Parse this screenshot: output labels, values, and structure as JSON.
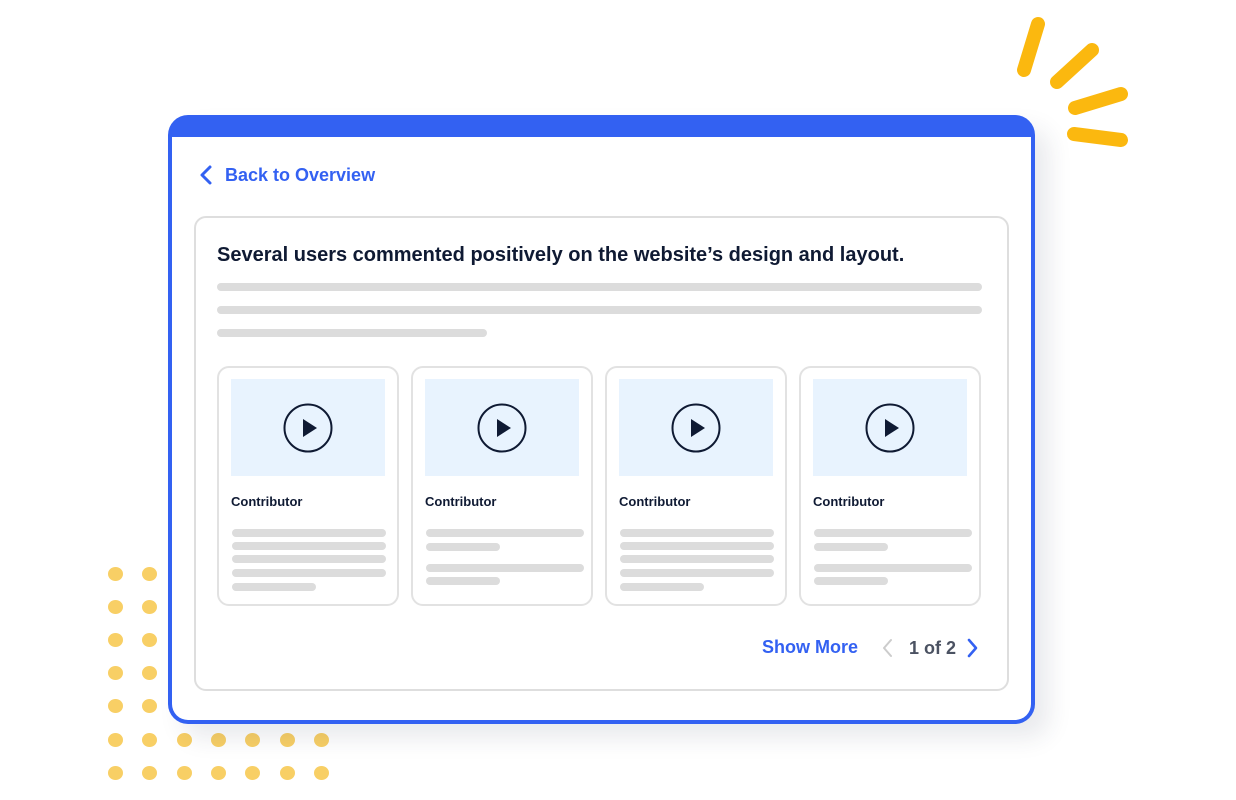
{
  "nav": {
    "back_label": "Back to Overview"
  },
  "insight": {
    "headline": "Several users commented positively on the website’s design and layout."
  },
  "cards": [
    {
      "title": "Contributor"
    },
    {
      "title": "Contributor"
    },
    {
      "title": "Contributor"
    },
    {
      "title": "Contributor"
    }
  ],
  "footer": {
    "show_more_label": "Show More",
    "page_indicator": "1 of 2"
  },
  "icons": {
    "back": "chevron-left-icon",
    "play": "play-icon",
    "prev": "chevron-left-icon",
    "next": "chevron-right-icon"
  },
  "colors": {
    "accent": "#3361f2",
    "text_dark": "#0f1a33",
    "thumbnail_bg": "#e8f3fe",
    "skeleton": "#dcdcdc",
    "decor_dots": "#f8cf65",
    "decor_burst": "#fbb80f",
    "pager_disabled": "#cccccc"
  }
}
